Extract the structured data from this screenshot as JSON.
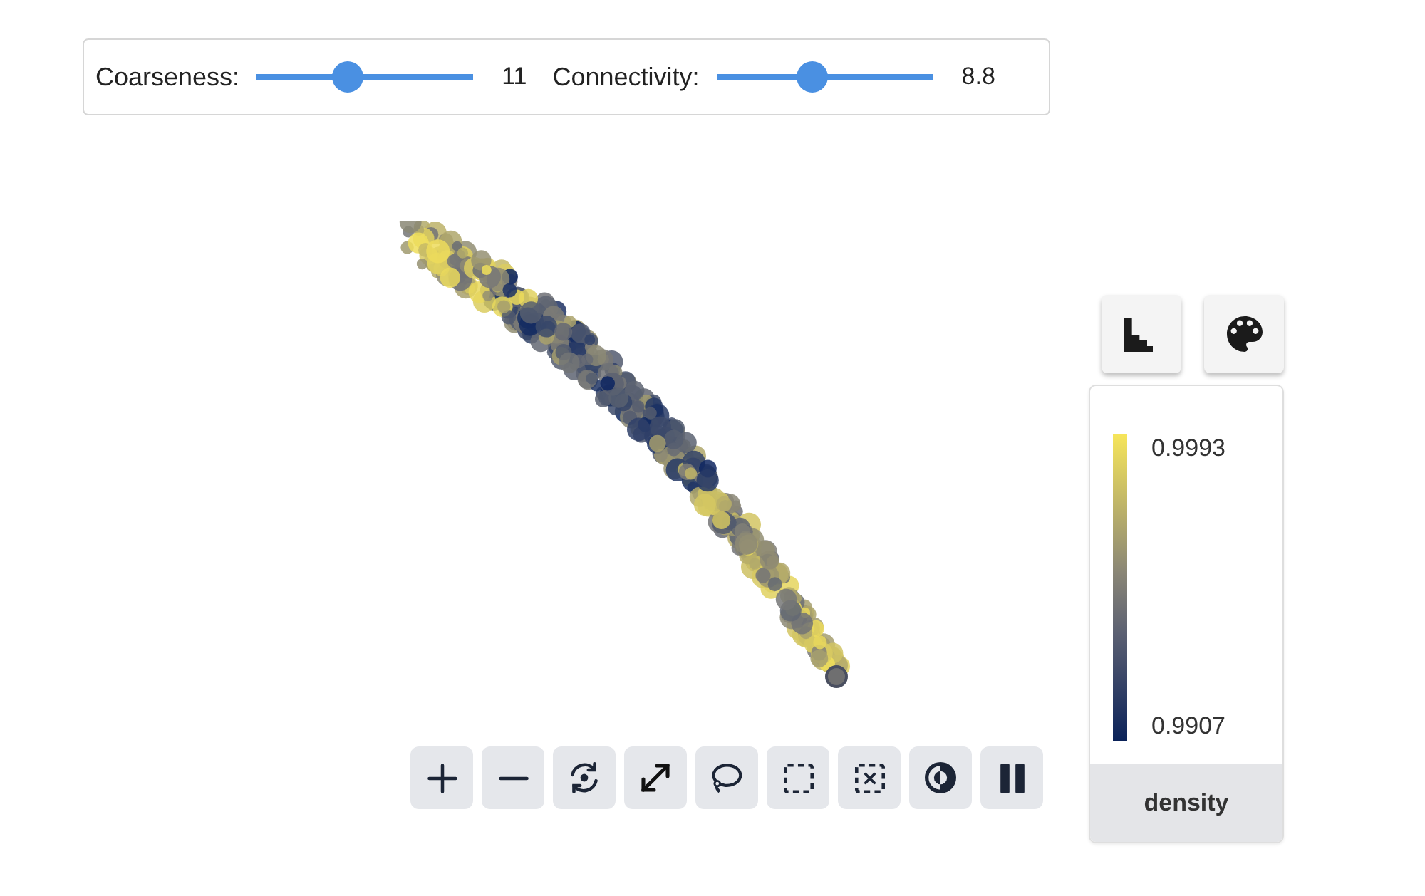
{
  "sliders": [
    {
      "label": "Coarseness:",
      "level": 0.41,
      "reading": "11"
    },
    {
      "label": "Connectivity:",
      "level": 0.43,
      "reading": "8.8"
    }
  ],
  "legend": {
    "max_label": "0.9993",
    "min_label": "0.9907",
    "title": "density"
  }
}
